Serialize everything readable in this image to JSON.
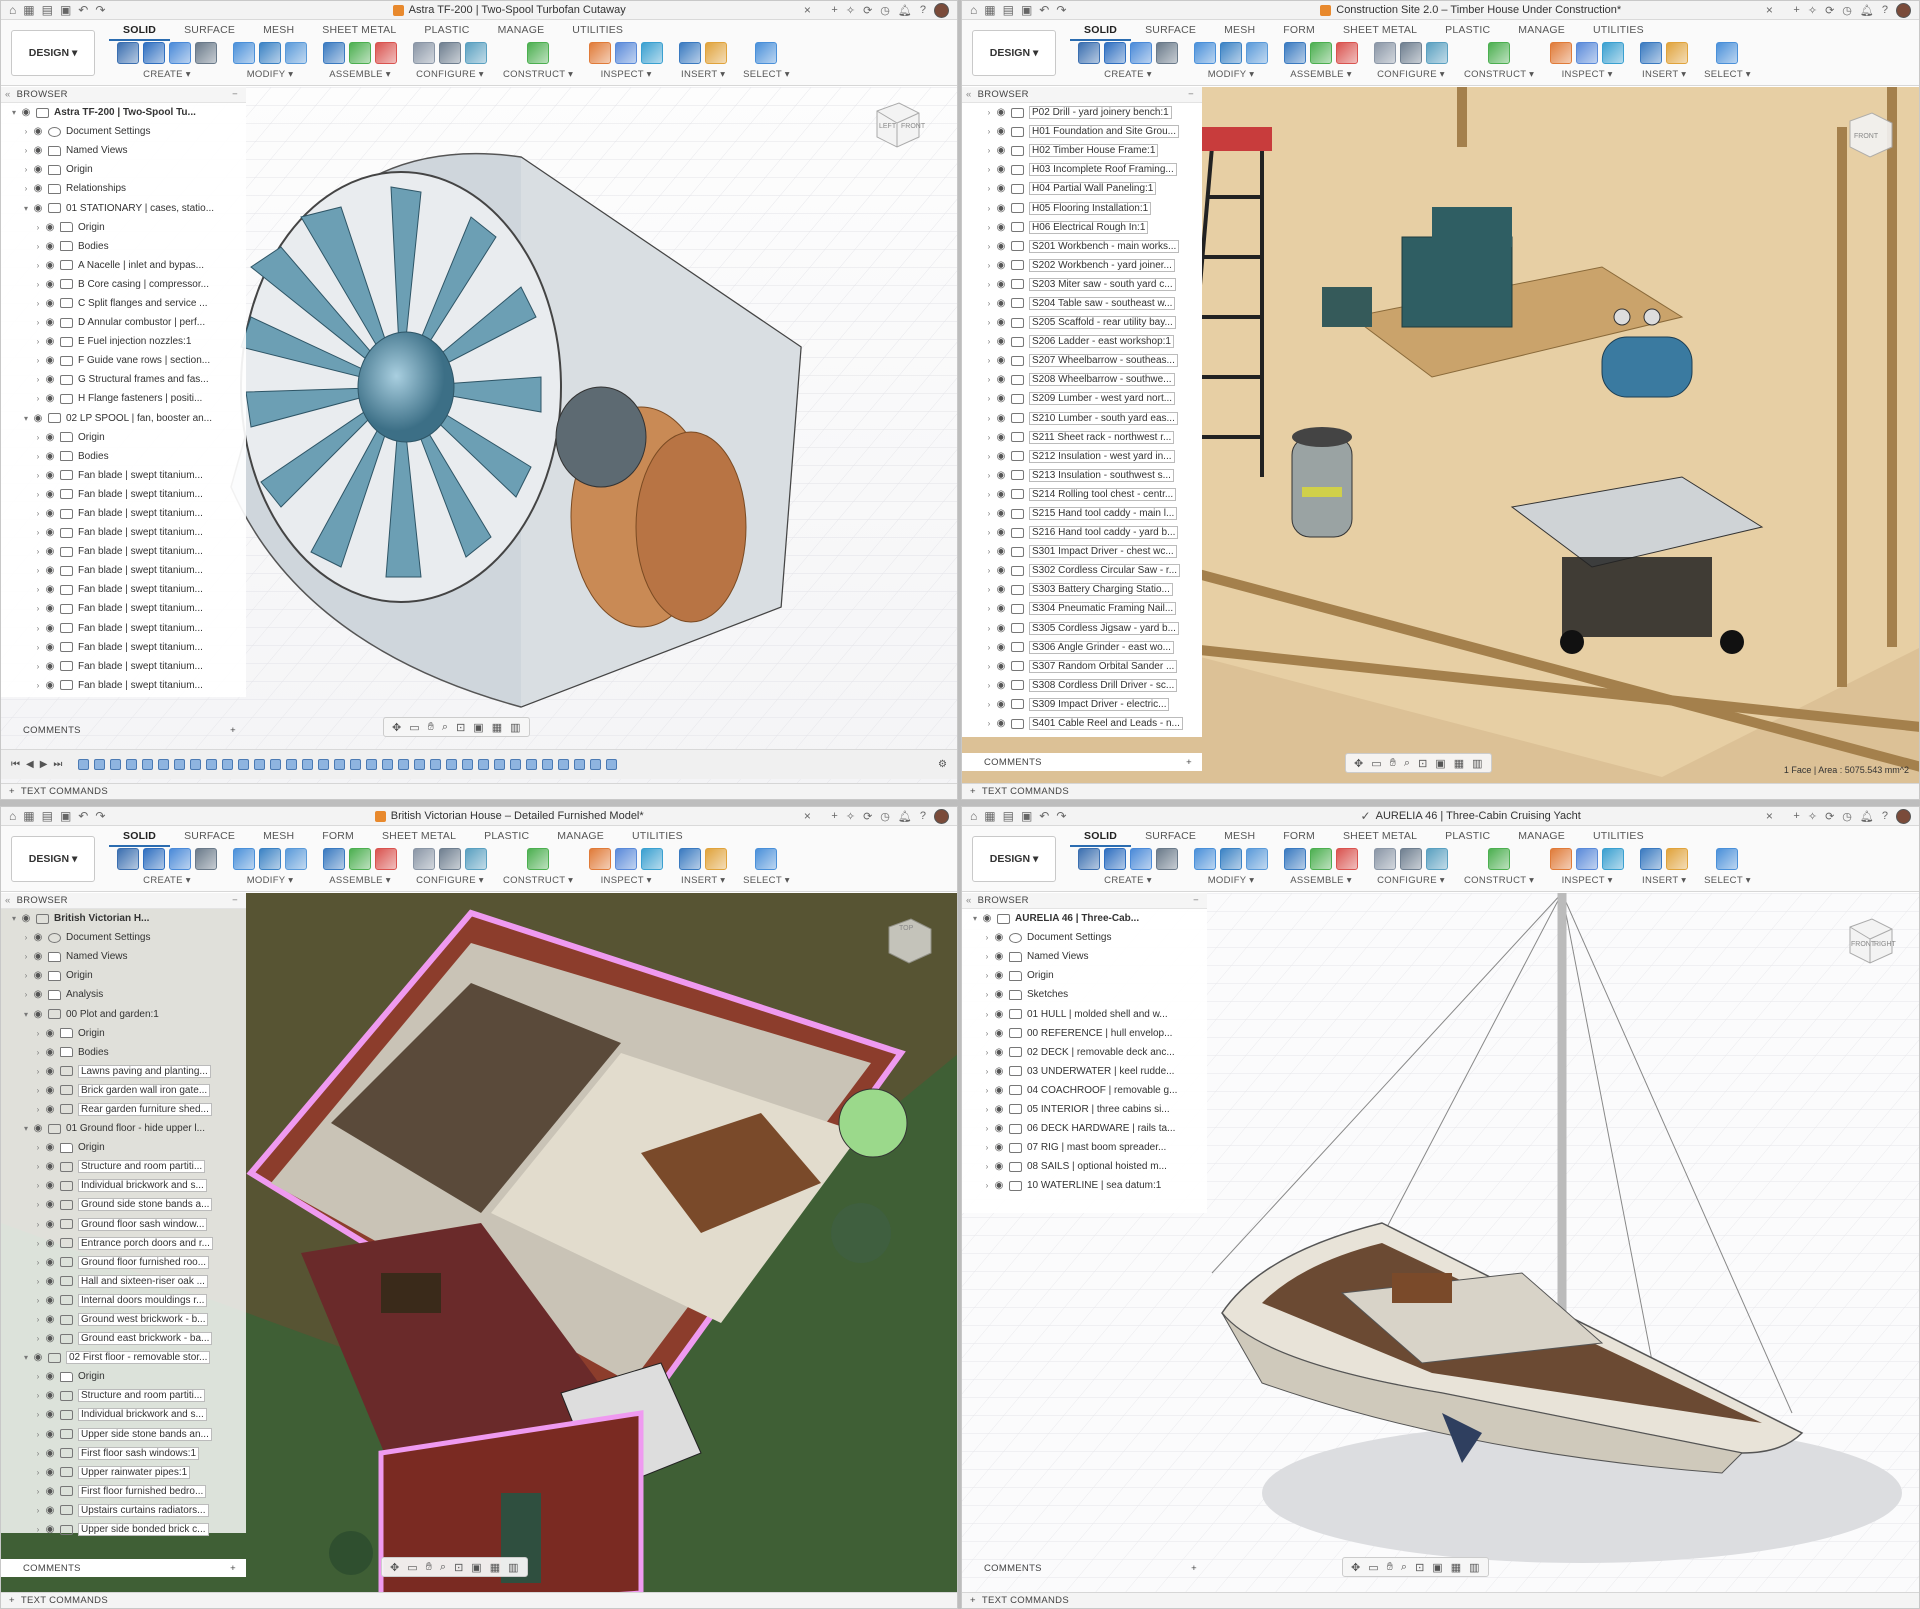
{
  "toolbar_common": {
    "design_label": "DESIGN ▾",
    "tabs_q1": [
      "SOLID",
      "SURFACE",
      "MESH",
      "SHEET METAL",
      "PLASTIC",
      "MANAGE",
      "UTILITIES"
    ],
    "tabs_other": [
      "SOLID",
      "SURFACE",
      "MESH",
      "FORM",
      "SHEET METAL",
      "PLASTIC",
      "MANAGE",
      "UTILITIES"
    ],
    "groups": [
      "CREATE ▾",
      "MODIFY ▾",
      "ASSEMBLE ▾",
      "CONFIGURE ▾",
      "CONSTRUCT ▾",
      "INSPECT ▾",
      "INSERT ▾",
      "SELECT ▾"
    ],
    "browser_label": "BROWSER",
    "comments_label": "COMMENTS",
    "text_commands_label": "TEXT COMMANDS"
  },
  "q1": {
    "title": "Astra TF-200 | Two-Spool Turbofan Cutaway",
    "tree": [
      {
        "d": 0,
        "a": "v",
        "icon": "doc",
        "label": "Astra TF-200 | Two-Spool Tu...",
        "bold": true
      },
      {
        "d": 1,
        "a": ">",
        "icon": "gear",
        "label": "Document Settings"
      },
      {
        "d": 1,
        "a": ">",
        "icon": "folder",
        "label": "Named Views"
      },
      {
        "d": 1,
        "a": ">",
        "icon": "folder",
        "label": "Origin"
      },
      {
        "d": 1,
        "a": ">",
        "icon": "folder",
        "label": "Relationships"
      },
      {
        "d": 1,
        "a": "v",
        "icon": "comp",
        "label": "01 STATIONARY | cases, statio..."
      },
      {
        "d": 2,
        "a": ">",
        "icon": "folder",
        "label": "Origin"
      },
      {
        "d": 2,
        "a": ">",
        "icon": "folder",
        "label": "Bodies"
      },
      {
        "d": 2,
        "a": ">",
        "icon": "comp",
        "label": "A Nacelle | inlet and bypas..."
      },
      {
        "d": 2,
        "a": ">",
        "icon": "comp",
        "label": "B Core casing | compressor..."
      },
      {
        "d": 2,
        "a": ">",
        "icon": "comp",
        "label": "C Split flanges and service ..."
      },
      {
        "d": 2,
        "a": ">",
        "icon": "comp",
        "label": "D Annular combustor | perf..."
      },
      {
        "d": 2,
        "a": ">",
        "icon": "comp",
        "label": "E Fuel injection nozzles:1"
      },
      {
        "d": 2,
        "a": ">",
        "icon": "comp",
        "label": "F Guide vane rows | section..."
      },
      {
        "d": 2,
        "a": ">",
        "icon": "comp",
        "label": "G Structural frames and fas..."
      },
      {
        "d": 2,
        "a": ">",
        "icon": "comp",
        "label": "H Flange fasteners | positi..."
      },
      {
        "d": 1,
        "a": "v",
        "icon": "comp",
        "label": "02 LP SPOOL | fan, booster an..."
      },
      {
        "d": 2,
        "a": ">",
        "icon": "folder",
        "label": "Origin"
      },
      {
        "d": 2,
        "a": ">",
        "icon": "folder",
        "label": "Bodies"
      },
      {
        "d": 2,
        "a": ">",
        "icon": "link",
        "label": "Fan blade | swept titanium..."
      },
      {
        "d": 2,
        "a": ">",
        "icon": "link",
        "label": "Fan blade | swept titanium..."
      },
      {
        "d": 2,
        "a": ">",
        "icon": "link",
        "label": "Fan blade | swept titanium..."
      },
      {
        "d": 2,
        "a": ">",
        "icon": "link",
        "label": "Fan blade | swept titanium..."
      },
      {
        "d": 2,
        "a": ">",
        "icon": "link",
        "label": "Fan blade | swept titanium..."
      },
      {
        "d": 2,
        "a": ">",
        "icon": "link",
        "label": "Fan blade | swept titanium..."
      },
      {
        "d": 2,
        "a": ">",
        "icon": "link",
        "label": "Fan blade | swept titanium..."
      },
      {
        "d": 2,
        "a": ">",
        "icon": "link",
        "label": "Fan blade | swept titanium..."
      },
      {
        "d": 2,
        "a": ">",
        "icon": "link",
        "label": "Fan blade | swept titanium..."
      },
      {
        "d": 2,
        "a": ">",
        "icon": "link",
        "label": "Fan blade | swept titanium..."
      },
      {
        "d": 2,
        "a": ">",
        "icon": "link",
        "label": "Fan blade | swept titanium..."
      },
      {
        "d": 2,
        "a": ">",
        "icon": "link",
        "label": "Fan blade | swept titanium..."
      }
    ],
    "viewcube": [
      "LEFT",
      "FRONT"
    ]
  },
  "q2": {
    "title": "Construction Site 2.0 – Timber House Under Construction*",
    "tree": [
      "P02 Drill - yard joinery bench:1",
      "H01 Foundation and Site Grou...",
      "H02 Timber House Frame:1",
      "H03 Incomplete Roof Framing...",
      "H04 Partial Wall Paneling:1",
      "H05 Flooring Installation:1",
      "H06 Electrical Rough In:1",
      "S201 Workbench - main works...",
      "S202 Workbench - yard joiner...",
      "S203 Miter saw - south yard c...",
      "S204 Table saw - southeast w...",
      "S205 Scaffold - rear utility bay...",
      "S206 Ladder - east workshop:1",
      "S207 Wheelbarrow - southeas...",
      "S208 Wheelbarrow - southwe...",
      "S209 Lumber - west yard nort...",
      "S210 Lumber - south yard eas...",
      "S211 Sheet rack - northwest r...",
      "S212 Insulation - west yard in...",
      "S213 Insulation - southwest s...",
      "S214 Rolling tool chest - centr...",
      "S215 Hand tool caddy - main l...",
      "S216 Hand tool caddy - yard b...",
      "S301 Impact Driver - chest wc...",
      "S302 Cordless Circular Saw - r...",
      "S303 Battery Charging Statio...",
      "S304 Pneumatic Framing Nail...",
      "S305 Cordless Jigsaw - yard b...",
      "S306 Angle Grinder - east wo...",
      "S307 Random Orbital Sander ...",
      "S308 Cordless Drill Driver - sc...",
      "S309 Impact Driver - electric...",
      "S401 Cable Reel and Leads - n..."
    ],
    "viewcube": [
      "FRONT"
    ],
    "status": "1 Face | Area : 5075.543 mm^2"
  },
  "q3": {
    "title": "British Victorian House – Detailed Furnished Model*",
    "tree": [
      {
        "d": 0,
        "a": "v",
        "icon": "doc",
        "label": "British Victorian H...",
        "bold": true
      },
      {
        "d": 1,
        "a": ">",
        "icon": "gear",
        "label": "Document Settings"
      },
      {
        "d": 1,
        "a": ">",
        "icon": "folder",
        "label": "Named Views"
      },
      {
        "d": 1,
        "a": ">",
        "icon": "folder",
        "label": "Origin"
      },
      {
        "d": 1,
        "a": ">",
        "icon": "folder",
        "label": "Analysis"
      },
      {
        "d": 1,
        "a": "v",
        "icon": "comp",
        "label": "00 Plot and garden:1"
      },
      {
        "d": 2,
        "a": ">",
        "icon": "folder",
        "label": "Origin"
      },
      {
        "d": 2,
        "a": ">",
        "icon": "folder",
        "label": "Bodies"
      },
      {
        "d": 2,
        "a": ">",
        "icon": "comp",
        "label": "Lawns paving and planting...",
        "hl": true
      },
      {
        "d": 2,
        "a": ">",
        "icon": "comp",
        "label": "Brick garden wall iron gate...",
        "hl": true
      },
      {
        "d": 2,
        "a": ">",
        "icon": "comp",
        "label": "Rear garden furniture shed...",
        "hl": true
      },
      {
        "d": 1,
        "a": "v",
        "icon": "comp",
        "label": "01 Ground floor - hide upper l..."
      },
      {
        "d": 2,
        "a": ">",
        "icon": "folder",
        "label": "Origin"
      },
      {
        "d": 2,
        "a": ">",
        "icon": "comp",
        "label": "Structure and room partiti...",
        "hl": true
      },
      {
        "d": 2,
        "a": ">",
        "icon": "comp",
        "label": "Individual brickwork and s...",
        "hl": true
      },
      {
        "d": 2,
        "a": ">",
        "icon": "comp",
        "label": "Ground side stone bands a...",
        "hl": true
      },
      {
        "d": 2,
        "a": ">",
        "icon": "comp",
        "label": "Ground floor sash window...",
        "hl": true
      },
      {
        "d": 2,
        "a": ">",
        "icon": "comp",
        "label": "Entrance porch doors and r...",
        "hl": true
      },
      {
        "d": 2,
        "a": ">",
        "icon": "comp",
        "label": "Ground floor furnished roo...",
        "hl": true
      },
      {
        "d": 2,
        "a": ">",
        "icon": "comp",
        "label": "Hall and sixteen-riser oak ...",
        "hl": true
      },
      {
        "d": 2,
        "a": ">",
        "icon": "comp",
        "label": "Internal doors mouldings r...",
        "hl": true
      },
      {
        "d": 2,
        "a": ">",
        "icon": "comp",
        "label": "Ground west brickwork - b...",
        "hl": true
      },
      {
        "d": 2,
        "a": ">",
        "icon": "comp",
        "label": "Ground east brickwork - ba...",
        "hl": true
      },
      {
        "d": 1,
        "a": "v",
        "icon": "comp",
        "label": "02 First floor - removable stor...",
        "hl": true
      },
      {
        "d": 2,
        "a": ">",
        "icon": "folder",
        "label": "Origin"
      },
      {
        "d": 2,
        "a": ">",
        "icon": "comp",
        "label": "Structure and room partiti...",
        "hl": true
      },
      {
        "d": 2,
        "a": ">",
        "icon": "comp",
        "label": "Individual brickwork and s...",
        "hl": true
      },
      {
        "d": 2,
        "a": ">",
        "icon": "comp",
        "label": "Upper side stone bands an...",
        "hl": true
      },
      {
        "d": 2,
        "a": ">",
        "icon": "comp",
        "label": "First floor sash windows:1",
        "hl": true
      },
      {
        "d": 2,
        "a": ">",
        "icon": "comp",
        "label": "Upper rainwater pipes:1",
        "hl": true
      },
      {
        "d": 2,
        "a": ">",
        "icon": "comp",
        "label": "First floor furnished bedro...",
        "hl": true
      },
      {
        "d": 2,
        "a": ">",
        "icon": "comp",
        "label": "Upstairs curtains radiators...",
        "hl": true
      },
      {
        "d": 2,
        "a": ">",
        "icon": "comp",
        "label": "Upper side bonded brick c...",
        "hl": true
      }
    ],
    "viewcube": [
      "TOP"
    ]
  },
  "q4": {
    "title": "AURELIA 46 | Three-Cabin Cruising Yacht",
    "tree": [
      {
        "d": 0,
        "a": "v",
        "icon": "doc",
        "label": "AURELIA 46 | Three-Cab...",
        "bold": true
      },
      {
        "d": 1,
        "a": ">",
        "icon": "gear",
        "label": "Document Settings"
      },
      {
        "d": 1,
        "a": ">",
        "icon": "folder",
        "label": "Named Views"
      },
      {
        "d": 1,
        "a": ">",
        "icon": "folder",
        "label": "Origin"
      },
      {
        "d": 1,
        "a": ">",
        "icon": "folder",
        "label": "Sketches"
      },
      {
        "d": 1,
        "a": ">",
        "icon": "comp",
        "label": "01 HULL | molded shell and w..."
      },
      {
        "d": 1,
        "a": ">",
        "icon": "comp",
        "label": "00 REFERENCE | hull envelop..."
      },
      {
        "d": 1,
        "a": ">",
        "icon": "comp",
        "label": "02 DECK | removable deck anc..."
      },
      {
        "d": 1,
        "a": ">",
        "icon": "comp",
        "label": "03 UNDERWATER | keel rudde..."
      },
      {
        "d": 1,
        "a": ">",
        "icon": "comp",
        "label": "04 COACHROOF | removable g..."
      },
      {
        "d": 1,
        "a": ">",
        "icon": "comp",
        "label": "05 INTERIOR | three cabins si..."
      },
      {
        "d": 1,
        "a": ">",
        "icon": "comp",
        "label": "06 DECK HARDWARE | rails ta..."
      },
      {
        "d": 1,
        "a": ">",
        "icon": "comp",
        "label": "07 RIG | mast boom spreader..."
      },
      {
        "d": 1,
        "a": ">",
        "icon": "comp",
        "label": "08 SAILS | optional hoisted m..."
      },
      {
        "d": 1,
        "a": ">",
        "icon": "comp",
        "label": "10 WATERLINE | sea datum:1"
      }
    ],
    "viewcube": [
      "FRONT",
      "RIGHT"
    ]
  },
  "colors": {
    "accent": "#2b6cb0",
    "create": "#3b82c4",
    "modify": "#4a90d9",
    "construct": "#e07b39",
    "inspect": "#e8a33c"
  }
}
